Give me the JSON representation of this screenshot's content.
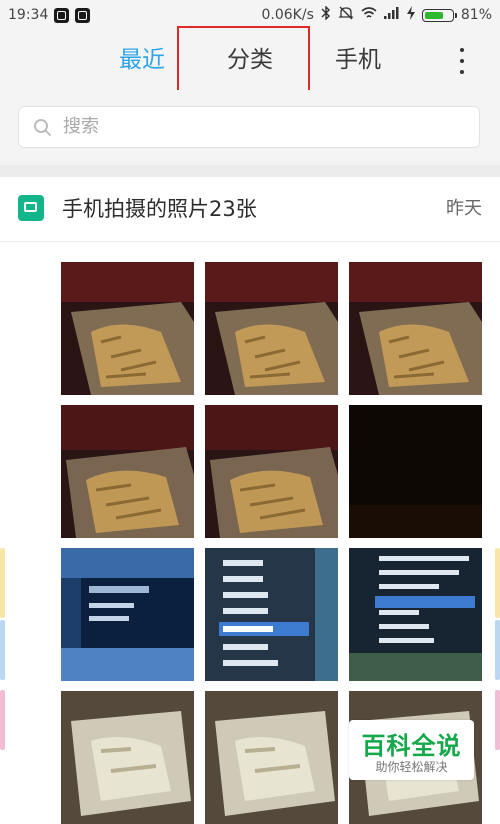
{
  "status_bar": {
    "time": "19:34",
    "network_speed": "0.06K/s",
    "battery_percent": "81%",
    "battery_level": 0.81
  },
  "tabs": [
    {
      "label": "最近",
      "active": true
    },
    {
      "label": "分类",
      "active": false
    },
    {
      "label": "手机",
      "active": false
    }
  ],
  "search": {
    "placeholder": "搜索"
  },
  "album": {
    "title": "手机拍摄的照片23张",
    "date": "昨天"
  },
  "watermark": {
    "main": "百科全说",
    "sub": "助你轻松解决"
  },
  "colors": {
    "accent": "#2fa5e8",
    "highlight_box": "#e02a2a",
    "album_icon": "#13b58a",
    "battery": "#2fb82f"
  }
}
